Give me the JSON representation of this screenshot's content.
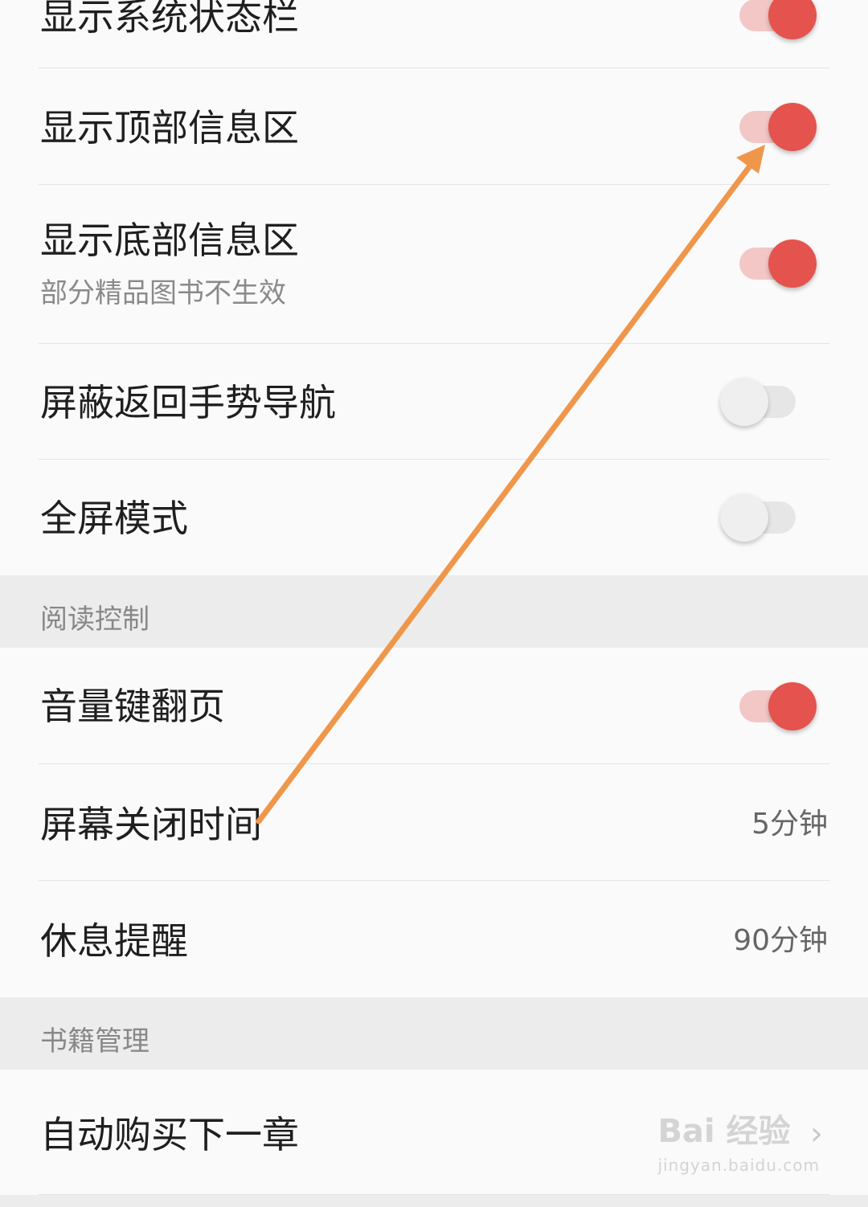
{
  "settings": {
    "display": [
      {
        "title": "显示系统状态栏",
        "toggle": true
      },
      {
        "title": "显示顶部信息区",
        "toggle": true
      },
      {
        "title": "显示底部信息区",
        "subtitle": "部分精品图书不生效",
        "toggle": true
      },
      {
        "title": "屏蔽返回手势导航",
        "toggle": false
      },
      {
        "title": "全屏模式",
        "toggle": false
      }
    ],
    "reading_section": {
      "label": "阅读控制",
      "items": [
        {
          "title": "音量键翻页",
          "toggle": true
        },
        {
          "title": "屏幕关闭时间",
          "value": "5分钟"
        },
        {
          "title": "休息提醒",
          "value": "90分钟"
        }
      ]
    },
    "books_section": {
      "label": "书籍管理",
      "items": [
        {
          "title": "自动购买下一章"
        }
      ]
    }
  },
  "watermark": {
    "main": "Bai 经验",
    "sub": "jingyan.baidu.com"
  },
  "icons": {
    "arrow": "annotation-arrow-icon",
    "chevron": "chevron-right-icon"
  },
  "colors": {
    "toggle_on_knob": "#e4534d",
    "toggle_on_track": "#f4c7c7",
    "toggle_off_knob": "#efefef",
    "annotation_arrow": "#f0964a",
    "section_bg": "#ececec"
  }
}
